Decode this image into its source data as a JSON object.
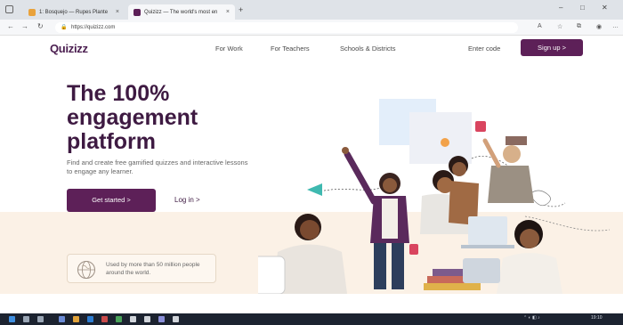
{
  "browser": {
    "tabs": [
      {
        "label": "1: Bosquejo — Rupes Plante",
        "active": false
      },
      {
        "label": "Quizizz — The world's most en",
        "active": true
      }
    ],
    "url": "https://quizizz.com",
    "new_tab": "+",
    "close_glyph": "×"
  },
  "header": {
    "logo": "Quizizz",
    "nav": [
      "For Work",
      "For Teachers",
      "Schools & Districts"
    ],
    "enter_code": "Enter code",
    "signup": "Sign up  >"
  },
  "hero": {
    "headline_lines": [
      "The 100%",
      "engagement",
      "platform"
    ],
    "subtext": "Find and create free gamified quizzes and interactive lessons to engage any learner.",
    "get_started": "Get started  >",
    "login": "Log in  >",
    "users_card": "Used by more than 50 million people around the world."
  },
  "taskbar": {
    "tray_text": "19:10"
  },
  "colors": {
    "brand": "#5d2058",
    "heading": "#3e1a42",
    "band": "#fbf1e6",
    "taskbar": "#1c2330"
  }
}
